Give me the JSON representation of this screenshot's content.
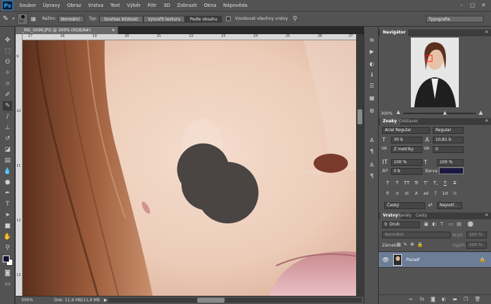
{
  "app": {
    "logo": "Ps"
  },
  "menu": [
    "Soubor",
    "Úpravy",
    "Obraz",
    "Vrstva",
    "Text",
    "Výběr",
    "Filtr",
    "3D",
    "Zobrazit",
    "Okna",
    "Nápověda"
  ],
  "window_controls": [
    "–",
    "□",
    "✕"
  ],
  "options": {
    "brush_size": "50",
    "mode_label": "Režim:",
    "mode_value": "Normální",
    "type_label": "Typ:",
    "type_buttons": [
      "Souhlas blízkosti",
      "Vytvořit texturu",
      "Podle obsahu"
    ],
    "sample_all_label": "Vzorkovat všechny vrstvy",
    "workspace": "Typografie"
  },
  "document": {
    "tab_title": "_MG_0099.JPG @ 300% (RGB/8#)",
    "ruler_h": [
      "17",
      "18",
      "19",
      "20",
      "21",
      "22",
      "23",
      "24",
      "25",
      "26",
      "27"
    ],
    "ruler_v": [
      "9",
      "10",
      "11",
      "12",
      "13"
    ],
    "status_zoom": "300%",
    "status_doc": "Dok: 11,9 MB/11,9 MB"
  },
  "navigator": {
    "title": "Navigátor",
    "zoom": "300%"
  },
  "character": {
    "tabs": [
      "Znaky",
      "Odstavec"
    ],
    "font": "Arial Regular",
    "style": "Regular",
    "size": "30 b",
    "leading": "10,81 b",
    "kerning": "Z metriky",
    "tracking": "0",
    "v_scale": "100 %",
    "h_scale": "100 %",
    "baseline": "0 b",
    "color_label": "Barva:",
    "color_value": "#1a1740",
    "type_buttons": [
      "T",
      "T",
      "TT",
      "Tr",
      "T'",
      "T,",
      "T",
      "T"
    ],
    "opentype_buttons": [
      "fi",
      "ơ",
      "st",
      "A",
      "ad",
      "T",
      "1st",
      "½"
    ],
    "language": "Český",
    "aa_label": "aa",
    "aa_value": "Nejostř..."
  },
  "layers": {
    "tabs": [
      "Vrstvy",
      "Kanály",
      "Cesty"
    ],
    "filter": "Druh",
    "blend": "Normální",
    "opacity_label": "Krytí:",
    "opacity_value": "100 %",
    "lock_label": "Zámek:",
    "fill_label": "Výplň:",
    "fill_value": "100 %",
    "layer_name": "Pozadí"
  },
  "colors": {
    "accent": "#31a8ff",
    "selected_layer": "#6d7d96"
  }
}
